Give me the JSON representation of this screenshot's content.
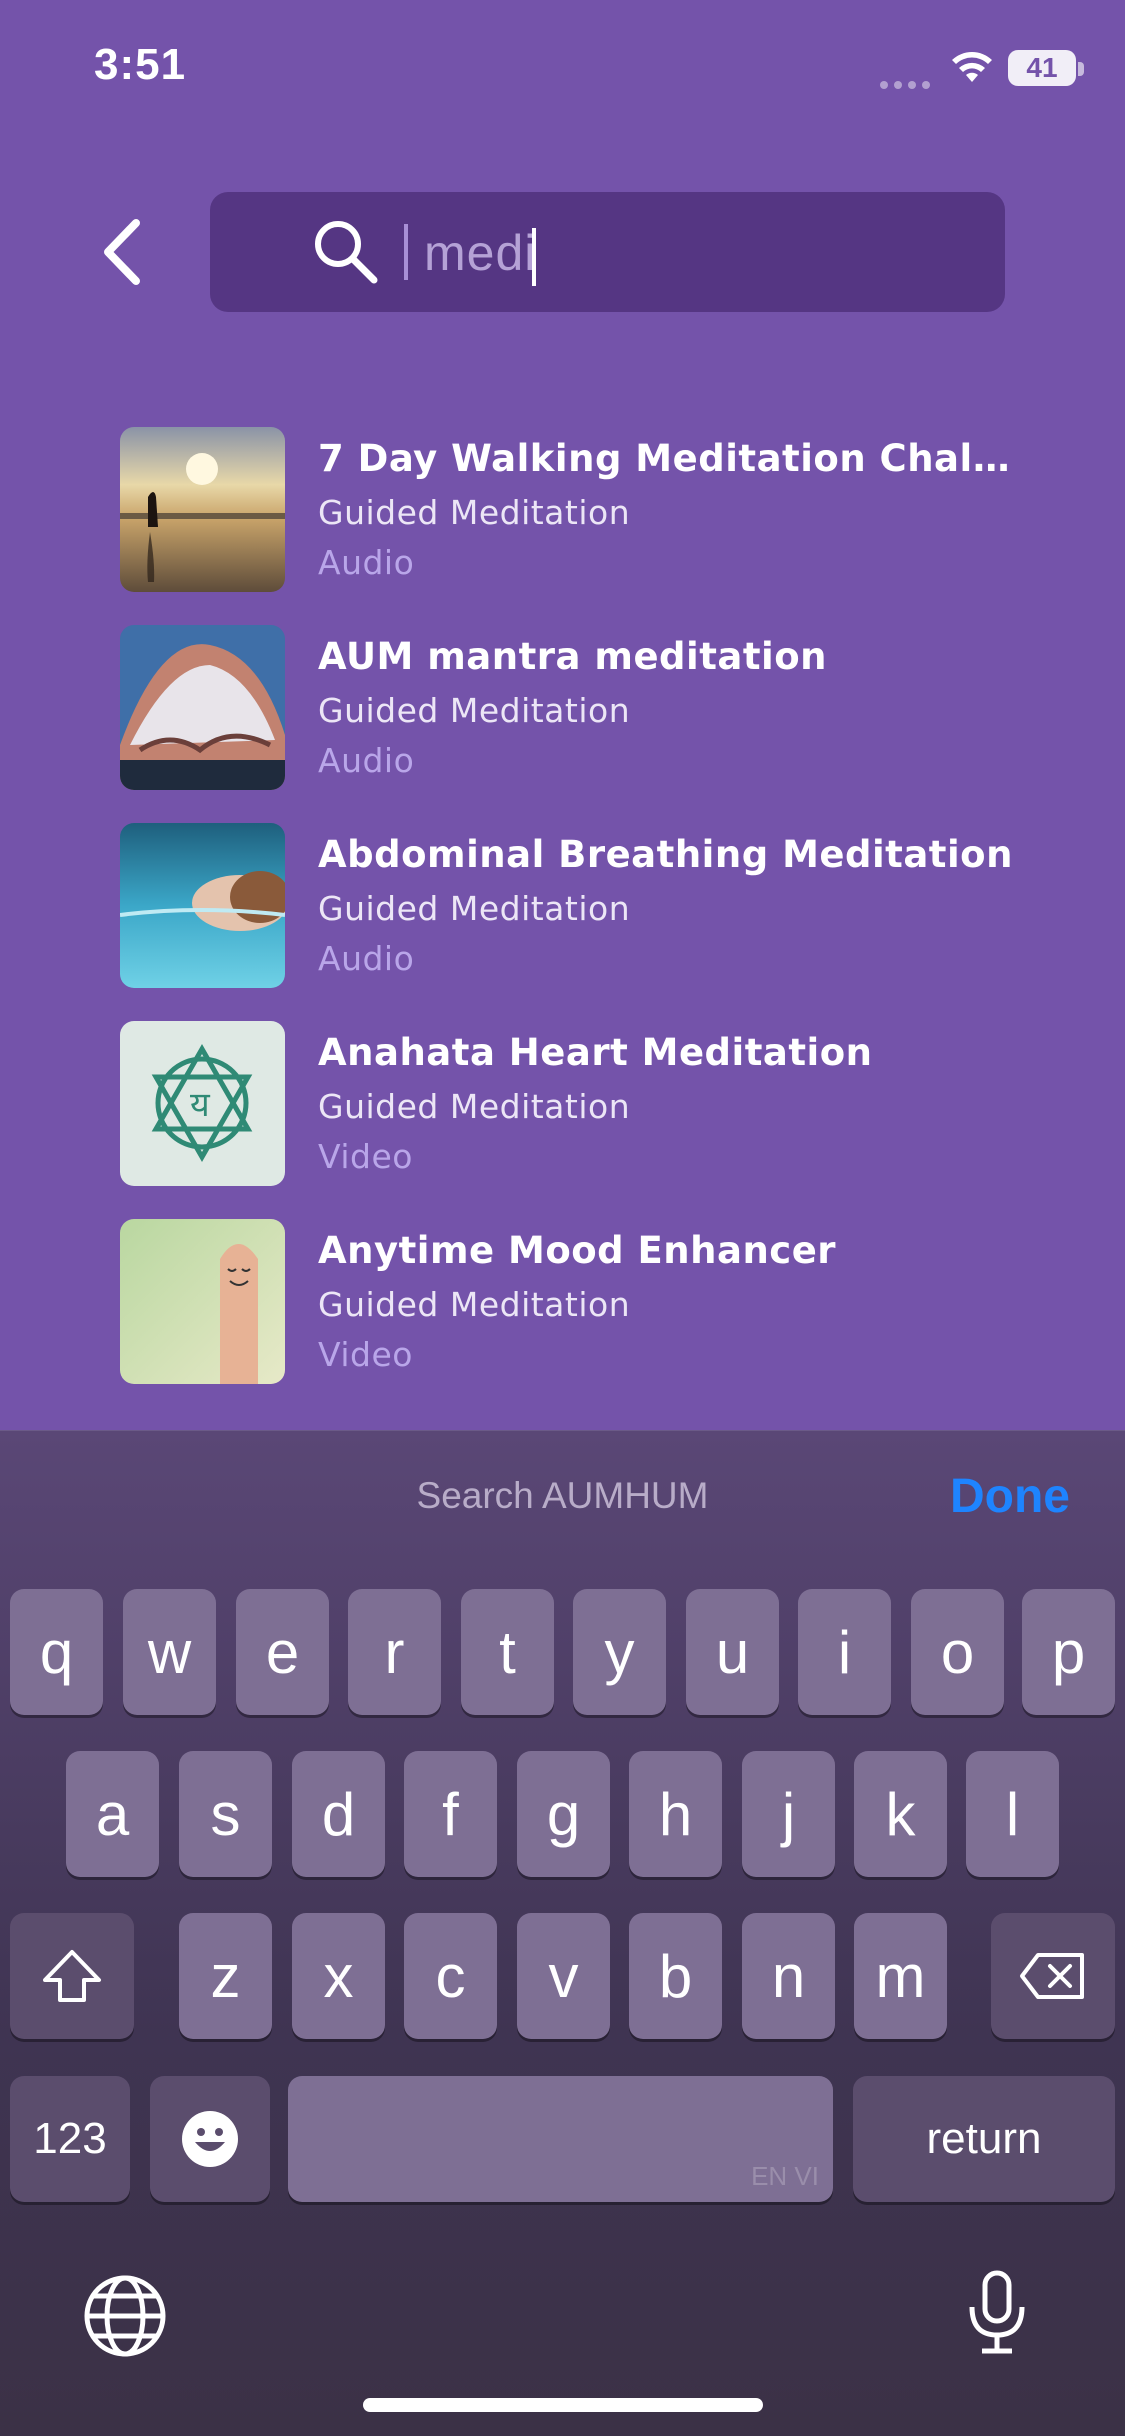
{
  "status_bar": {
    "time": "3:51",
    "battery": "41"
  },
  "search": {
    "typed_text": "medi",
    "back_icon": "chevron-left-icon",
    "search_icon": "search-icon"
  },
  "results": [
    {
      "title": "7 Day Walking Meditation Challen…",
      "category": "Guided Meditation",
      "type": "Audio"
    },
    {
      "title": "AUM mantra meditation",
      "category": "Guided Meditation",
      "type": "Audio"
    },
    {
      "title": "Abdominal Breathing Meditation",
      "category": "Guided Meditation",
      "type": "Audio"
    },
    {
      "title": "Anahata Heart Meditation",
      "category": "Guided Meditation",
      "type": "Video"
    },
    {
      "title": "Anytime Mood Enhancer",
      "category": "Guided Meditation",
      "type": "Video"
    }
  ],
  "keyboard": {
    "hint": "Search AUMHUM",
    "done_label": "Done",
    "row1": [
      "q",
      "w",
      "e",
      "r",
      "t",
      "y",
      "u",
      "i",
      "o",
      "p"
    ],
    "row2": [
      "a",
      "s",
      "d",
      "f",
      "g",
      "h",
      "j",
      "k",
      "l"
    ],
    "row3": [
      "z",
      "x",
      "c",
      "v",
      "b",
      "n",
      "m"
    ],
    "numbers_label": "123",
    "return_label": "return",
    "space_sub_label": "EN VI"
  },
  "colors": {
    "background": "#7453aa",
    "search_box": "#553683",
    "type_label": "#b9a6e9",
    "done": "#1e84ff"
  }
}
